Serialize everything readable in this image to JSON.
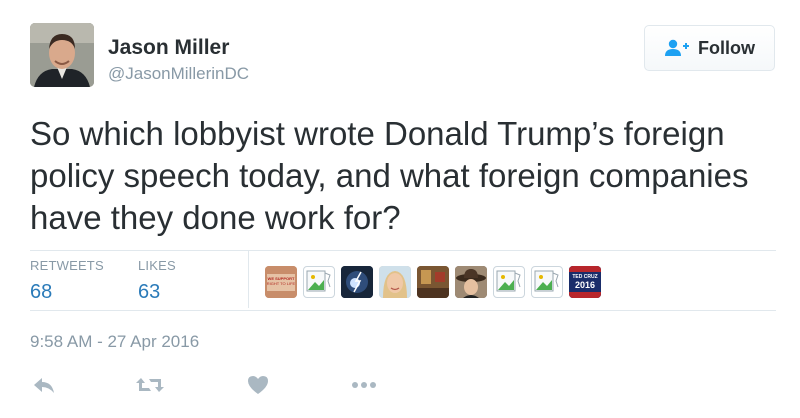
{
  "user": {
    "name": "Jason Miller",
    "handle": "@JasonMillerinDC"
  },
  "follow_button": {
    "label": "Follow",
    "icon": "follow-person-plus-icon"
  },
  "tweet": {
    "text": "So which lobbyist wrote Donald Trump’s foreign policy speech today, and what foreign companies have they done work for?"
  },
  "stats": {
    "retweets": {
      "label": "RETWEETS",
      "value": "68"
    },
    "likes": {
      "label": "LIKES",
      "value": "63"
    }
  },
  "liker_avatars": [
    {
      "name": "avatar-sign-image",
      "caption": "WE SUPPORT ... RIGHT TO LIFE"
    },
    {
      "name": "avatar-broken-image"
    },
    {
      "name": "avatar-lightning-image"
    },
    {
      "name": "avatar-woman-image"
    },
    {
      "name": "avatar-room-image"
    },
    {
      "name": "avatar-cowboy-hat-image"
    },
    {
      "name": "avatar-broken-image"
    },
    {
      "name": "avatar-broken-image"
    },
    {
      "name": "avatar-ted-cruz-2016-image",
      "caption": "TED CRUZ 2016"
    }
  ],
  "timestamp": "9:58 AM - 27 Apr 2016",
  "actions": [
    "reply-icon",
    "retweet-icon",
    "like-icon",
    "more-icon"
  ],
  "colors": {
    "text": "#292f33",
    "muted": "#8899a6",
    "link": "#2b7bb9",
    "border": "#e1e8ed"
  }
}
